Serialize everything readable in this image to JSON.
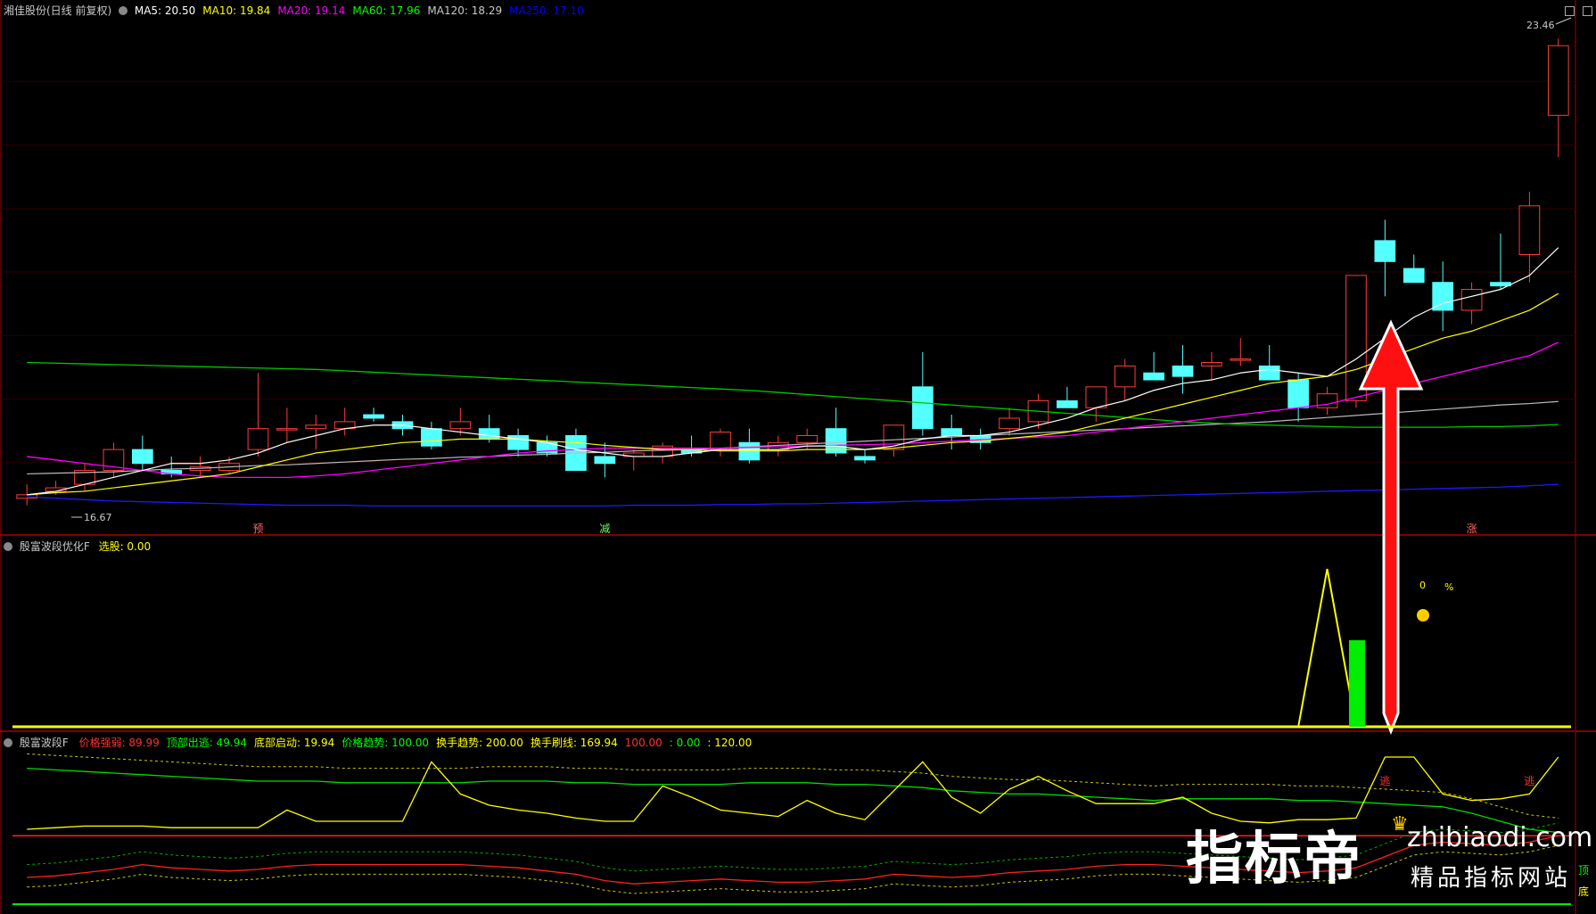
{
  "panel1": {
    "title": "湘佳股份(日线 前复权)",
    "ma": [
      {
        "label": "MA5: 20.50",
        "color": "#ffffff"
      },
      {
        "label": "MA10: 19.84",
        "color": "#ffff00"
      },
      {
        "label": "MA20: 19.14",
        "color": "#ff00ff"
      },
      {
        "label": "MA60: 17.96",
        "color": "#00ff00"
      },
      {
        "label": "MA120: 18.29",
        "color": "#c8c8c8"
      },
      {
        "label": "MA250: 17.10",
        "color": "#0000ff"
      }
    ],
    "price_high_label": "23.46",
    "price_low_label": "16.67",
    "signals": [
      {
        "text": "预",
        "color": "#ff6666",
        "x_index": 8
      },
      {
        "text": "减",
        "color": "#66ff66",
        "x_index": 20
      },
      {
        "text": "涨",
        "color": "#ff6666",
        "x_index": 50
      }
    ]
  },
  "panel2": {
    "title": "殷富波段优化F",
    "label": "选股: 0.00",
    "label_color": "#ffff00",
    "zero_label": "0",
    "percent_label": "%"
  },
  "panel3": {
    "title": "殷富波段F",
    "items": [
      {
        "label": "价格强弱: 89.99",
        "color": "#ff3030"
      },
      {
        "label": "顶部出逃: 49.94",
        "color": "#00ff00"
      },
      {
        "label": "底部启动: 19.94",
        "color": "#ffff00"
      },
      {
        "label": "价格趋势: 100.00",
        "color": "#00ff00"
      },
      {
        "label": "换手趋势: 200.00",
        "color": "#ffff00"
      },
      {
        "label": "换手刷线: 169.94",
        "color": "#ffff00"
      },
      {
        "label": "100.00",
        "color": "#ff3030"
      },
      {
        "label": "0.00",
        "color": "#00ff00"
      },
      {
        "label": "120.00",
        "color": "#ffff00"
      }
    ],
    "tags": [
      "逃",
      "逃",
      "顶",
      "底"
    ]
  },
  "watermark": {
    "big": "指标帝",
    "site": "zhibiaodi.com",
    "sub": "精品指标网站"
  },
  "chart_data": {
    "type": "candlestick",
    "candles": [
      [
        16.9,
        17.1,
        16.8,
        16.95
      ],
      [
        17.0,
        17.15,
        16.95,
        17.05
      ],
      [
        17.1,
        17.4,
        17.0,
        17.3
      ],
      [
        17.3,
        17.7,
        17.2,
        17.6
      ],
      [
        17.6,
        17.8,
        17.3,
        17.4
      ],
      [
        17.3,
        17.5,
        17.2,
        17.25
      ],
      [
        17.3,
        17.5,
        17.2,
        17.35
      ],
      [
        17.3,
        17.5,
        17.25,
        17.4
      ],
      [
        17.6,
        18.7,
        17.5,
        17.9
      ],
      [
        17.9,
        18.2,
        17.7,
        17.9
      ],
      [
        17.9,
        18.1,
        17.6,
        17.95
      ],
      [
        17.9,
        18.2,
        17.8,
        18.0
      ],
      [
        18.1,
        18.2,
        18.0,
        18.05
      ],
      [
        18.0,
        18.1,
        17.8,
        17.9
      ],
      [
        17.9,
        18.0,
        17.6,
        17.65
      ],
      [
        17.9,
        18.2,
        17.8,
        18.0
      ],
      [
        17.9,
        18.1,
        17.7,
        17.75
      ],
      [
        17.8,
        17.9,
        17.5,
        17.6
      ],
      [
        17.7,
        17.8,
        17.5,
        17.55
      ],
      [
        17.8,
        17.9,
        17.4,
        17.3
      ],
      [
        17.5,
        17.7,
        17.2,
        17.4
      ],
      [
        17.5,
        17.6,
        17.3,
        17.55
      ],
      [
        17.5,
        17.7,
        17.4,
        17.65
      ],
      [
        17.6,
        17.8,
        17.5,
        17.55
      ],
      [
        17.6,
        17.9,
        17.5,
        17.85
      ],
      [
        17.7,
        17.9,
        17.4,
        17.45
      ],
      [
        17.6,
        17.8,
        17.5,
        17.7
      ],
      [
        17.7,
        17.9,
        17.6,
        17.8
      ],
      [
        17.9,
        18.2,
        17.5,
        17.55
      ],
      [
        17.5,
        17.6,
        17.4,
        17.45
      ],
      [
        17.6,
        17.9,
        17.5,
        17.95
      ],
      [
        18.5,
        19.0,
        17.8,
        17.9
      ],
      [
        17.9,
        18.1,
        17.6,
        17.8
      ],
      [
        17.8,
        17.9,
        17.6,
        17.7
      ],
      [
        17.9,
        18.2,
        17.8,
        18.05
      ],
      [
        18.0,
        18.4,
        17.9,
        18.3
      ],
      [
        18.3,
        18.5,
        18.2,
        18.2
      ],
      [
        18.2,
        18.4,
        18.0,
        18.5
      ],
      [
        18.5,
        18.9,
        18.3,
        18.8
      ],
      [
        18.7,
        19.0,
        18.6,
        18.6
      ],
      [
        18.8,
        19.1,
        18.4,
        18.65
      ],
      [
        18.8,
        19.0,
        18.6,
        18.85
      ],
      [
        18.9,
        19.2,
        18.8,
        18.9
      ],
      [
        18.8,
        19.1,
        18.6,
        18.6
      ],
      [
        18.6,
        18.7,
        18.0,
        18.2
      ],
      [
        18.2,
        18.5,
        18.1,
        18.4
      ],
      [
        18.3,
        19.0,
        18.2,
        20.1
      ],
      [
        20.6,
        20.9,
        19.8,
        20.3
      ],
      [
        20.2,
        20.4,
        20.0,
        20.0
      ],
      [
        20.0,
        20.3,
        19.3,
        19.6
      ],
      [
        19.6,
        20.0,
        19.4,
        19.9
      ],
      [
        20.0,
        20.7,
        19.9,
        19.95
      ],
      [
        20.4,
        21.3,
        20.0,
        21.1
      ],
      [
        22.4,
        23.5,
        21.8,
        23.4
      ]
    ],
    "ma5": [
      16.95,
      17.0,
      17.1,
      17.2,
      17.3,
      17.4,
      17.4,
      17.45,
      17.55,
      17.7,
      17.8,
      17.9,
      17.95,
      17.95,
      17.9,
      17.85,
      17.8,
      17.75,
      17.7,
      17.6,
      17.55,
      17.5,
      17.5,
      17.55,
      17.6,
      17.6,
      17.6,
      17.65,
      17.65,
      17.6,
      17.65,
      17.75,
      17.8,
      17.8,
      17.85,
      17.95,
      18.05,
      18.2,
      18.3,
      18.45,
      18.55,
      18.6,
      18.7,
      18.75,
      18.7,
      18.65,
      18.9,
      19.2,
      19.5,
      19.7,
      19.8,
      19.9,
      20.1,
      20.5
    ],
    "ma10": [
      16.95,
      16.98,
      17.0,
      17.05,
      17.1,
      17.15,
      17.2,
      17.25,
      17.35,
      17.45,
      17.55,
      17.6,
      17.65,
      17.7,
      17.72,
      17.75,
      17.75,
      17.75,
      17.72,
      17.7,
      17.66,
      17.63,
      17.6,
      17.6,
      17.58,
      17.58,
      17.58,
      17.6,
      17.6,
      17.6,
      17.62,
      17.66,
      17.7,
      17.72,
      17.76,
      17.8,
      17.85,
      17.95,
      18.05,
      18.15,
      18.25,
      18.35,
      18.45,
      18.55,
      18.6,
      18.65,
      18.75,
      18.9,
      19.05,
      19.2,
      19.3,
      19.45,
      19.6,
      19.84
    ],
    "ma20": [
      17.5,
      17.45,
      17.4,
      17.35,
      17.3,
      17.25,
      17.22,
      17.2,
      17.2,
      17.2,
      17.22,
      17.25,
      17.3,
      17.35,
      17.4,
      17.45,
      17.5,
      17.55,
      17.58,
      17.6,
      17.62,
      17.62,
      17.62,
      17.62,
      17.62,
      17.63,
      17.64,
      17.65,
      17.66,
      17.67,
      17.68,
      17.7,
      17.72,
      17.74,
      17.76,
      17.78,
      17.8,
      17.85,
      17.9,
      17.95,
      18.0,
      18.05,
      18.1,
      18.15,
      18.2,
      18.25,
      18.35,
      18.45,
      18.55,
      18.65,
      18.75,
      18.85,
      18.95,
      19.14
    ],
    "ma60": [
      18.85,
      18.84,
      18.83,
      18.82,
      18.81,
      18.8,
      18.79,
      18.78,
      18.77,
      18.76,
      18.75,
      18.73,
      18.71,
      18.69,
      18.67,
      18.65,
      18.63,
      18.61,
      18.59,
      18.57,
      18.55,
      18.53,
      18.51,
      18.49,
      18.47,
      18.45,
      18.42,
      18.39,
      18.36,
      18.33,
      18.3,
      18.27,
      18.24,
      18.21,
      18.18,
      18.15,
      18.12,
      18.09,
      18.06,
      18.03,
      18.0,
      17.98,
      17.96,
      17.95,
      17.94,
      17.93,
      17.92,
      17.92,
      17.92,
      17.92,
      17.93,
      17.93,
      17.94,
      17.96
    ],
    "ma120": [
      17.25,
      17.26,
      17.27,
      17.28,
      17.3,
      17.32,
      17.33,
      17.35,
      17.37,
      17.38,
      17.4,
      17.42,
      17.44,
      17.46,
      17.47,
      17.49,
      17.5,
      17.52,
      17.53,
      17.55,
      17.56,
      17.58,
      17.59,
      17.6,
      17.62,
      17.64,
      17.66,
      17.68,
      17.7,
      17.72,
      17.74,
      17.76,
      17.78,
      17.8,
      17.82,
      17.84,
      17.86,
      17.88,
      17.9,
      17.92,
      17.94,
      17.96,
      17.98,
      18.0,
      18.03,
      18.06,
      18.09,
      18.12,
      18.15,
      18.18,
      18.21,
      18.24,
      18.26,
      18.29
    ],
    "ma250": [
      16.92,
      16.9,
      16.88,
      16.86,
      16.85,
      16.84,
      16.83,
      16.82,
      16.81,
      16.8,
      16.8,
      16.8,
      16.79,
      16.79,
      16.79,
      16.79,
      16.79,
      16.79,
      16.79,
      16.79,
      16.79,
      16.8,
      16.8,
      16.8,
      16.81,
      16.81,
      16.82,
      16.82,
      16.83,
      16.84,
      16.85,
      16.86,
      16.87,
      16.88,
      16.89,
      16.9,
      16.91,
      16.92,
      16.93,
      16.94,
      16.95,
      16.96,
      16.97,
      16.98,
      16.99,
      17.0,
      17.01,
      17.02,
      17.03,
      17.04,
      17.05,
      17.06,
      17.08,
      17.1
    ],
    "yrange": [
      16.5,
      23.8
    ],
    "panel2_line": [
      0,
      0,
      0,
      0,
      0,
      0,
      0,
      0,
      0,
      0,
      0,
      0,
      0,
      0,
      0,
      0,
      0,
      0,
      0,
      0,
      0,
      0,
      0,
      0,
      0,
      0,
      0,
      0,
      0,
      0,
      0,
      0,
      0,
      0,
      0,
      0,
      0,
      0,
      0,
      0,
      0,
      0,
      0,
      0,
      0,
      1,
      0,
      0,
      0,
      0,
      0,
      0,
      0,
      0
    ],
    "p3_red": [
      20,
      21,
      23,
      25,
      28,
      26,
      25,
      24,
      25,
      27,
      28,
      28,
      28,
      28,
      28,
      28,
      27,
      26,
      24,
      22,
      18,
      16,
      17,
      18,
      19,
      18,
      17,
      17,
      18,
      19,
      22,
      21,
      20,
      21,
      23,
      24,
      25,
      27,
      28,
      28,
      27,
      26,
      25,
      24,
      23,
      24,
      26,
      33,
      40,
      42,
      41,
      40,
      42,
      46
    ],
    "p3_green": [
      88,
      87,
      86,
      85,
      84,
      83,
      82,
      81,
      80,
      80,
      80,
      79,
      79,
      79,
      79,
      79,
      80,
      80,
      80,
      79,
      79,
      78,
      78,
      78,
      78,
      79,
      79,
      79,
      78,
      78,
      77,
      76,
      74,
      73,
      72,
      72,
      71,
      70,
      69,
      68,
      69,
      69,
      69,
      69,
      68,
      68,
      67,
      66,
      65,
      64,
      60,
      55,
      50,
      48
    ],
    "p3_yellow": [
      50,
      51,
      52,
      52,
      52,
      51,
      51,
      51,
      51,
      62,
      55,
      55,
      55,
      55,
      92,
      72,
      65,
      62,
      60,
      57,
      55,
      55,
      77,
      70,
      62,
      60,
      58,
      68,
      60,
      56,
      74,
      92,
      70,
      60,
      75,
      83,
      74,
      66,
      66,
      66,
      70,
      60,
      55,
      54,
      56,
      56,
      57,
      95,
      95,
      72,
      68,
      69,
      72,
      95
    ]
  }
}
